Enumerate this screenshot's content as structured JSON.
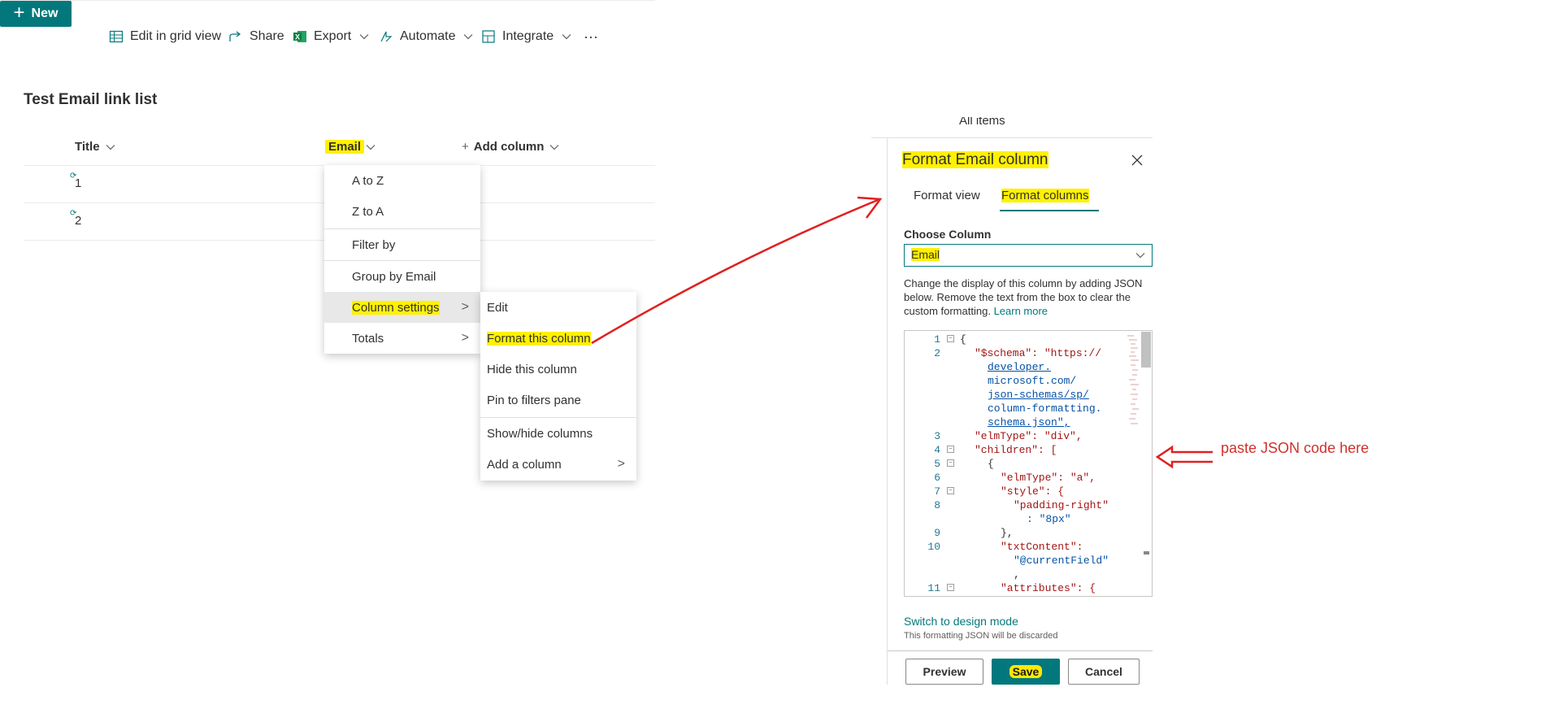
{
  "toolbar": {
    "new_label": "New",
    "edit_grid_label": "Edit in grid view",
    "share_label": "Share",
    "export_label": "Export",
    "automate_label": "Automate",
    "integrate_label": "Integrate",
    "more_label": "···"
  },
  "list": {
    "title": "Test Email link list",
    "columns": {
      "title": "Title",
      "email": "Email",
      "add": "Add column"
    },
    "rows": [
      "1",
      "2"
    ]
  },
  "column_menu": {
    "items": [
      "A to Z",
      "Z to A",
      "Filter by",
      "Group by Email",
      "Column settings",
      "Totals"
    ]
  },
  "settings_submenu": {
    "items": [
      "Edit",
      "Format this column",
      "Hide this column",
      "Pin to filters pane",
      "Show/hide columns",
      "Add a column"
    ]
  },
  "panel": {
    "partial_header": "All items",
    "title": "Format Email column",
    "tabs": {
      "view": "Format view",
      "columns": "Format columns"
    },
    "choose_label": "Choose Column",
    "selected_column": "Email",
    "description": "Change the display of this column by adding JSON below. Remove the text from the box to clear the custom formatting.",
    "learn_more": "Learn more",
    "code_lines": {
      "l1": "{",
      "l2a": "\"$schema\": \"https://",
      "l2b": "developer.",
      "l2c": "microsoft.com/",
      "l2d": "json-schemas/sp/",
      "l2e": "column-formatting.",
      "l2f": "schema.json\",",
      "l3": "\"elmType\": \"div\",",
      "l4": "\"children\": [",
      "l5": "{",
      "l6": "\"elmType\": \"a\",",
      "l7": "\"style\": {",
      "l8a": "\"padding-right\"",
      "l8b": ": \"8px\"",
      "l9": "},",
      "l10a": "\"txtContent\":",
      "l10b": "\"@currentField\"",
      "l10c": ",",
      "l11": "\"attributes\": {"
    },
    "line_numbers": [
      "1",
      "2",
      "3",
      "4",
      "5",
      "6",
      "7",
      "8",
      "9",
      "10",
      "11"
    ],
    "switch_link": "Switch to design mode",
    "discard_note": "This formatting JSON will be discarded",
    "buttons": {
      "preview": "Preview",
      "save": "Save",
      "cancel": "Cancel"
    }
  },
  "annotation": {
    "text": "paste JSON code here",
    "color": "#d0312d"
  },
  "colors": {
    "accent": "#03787c",
    "highlight": "#fff100",
    "arrow": "#e02020"
  }
}
